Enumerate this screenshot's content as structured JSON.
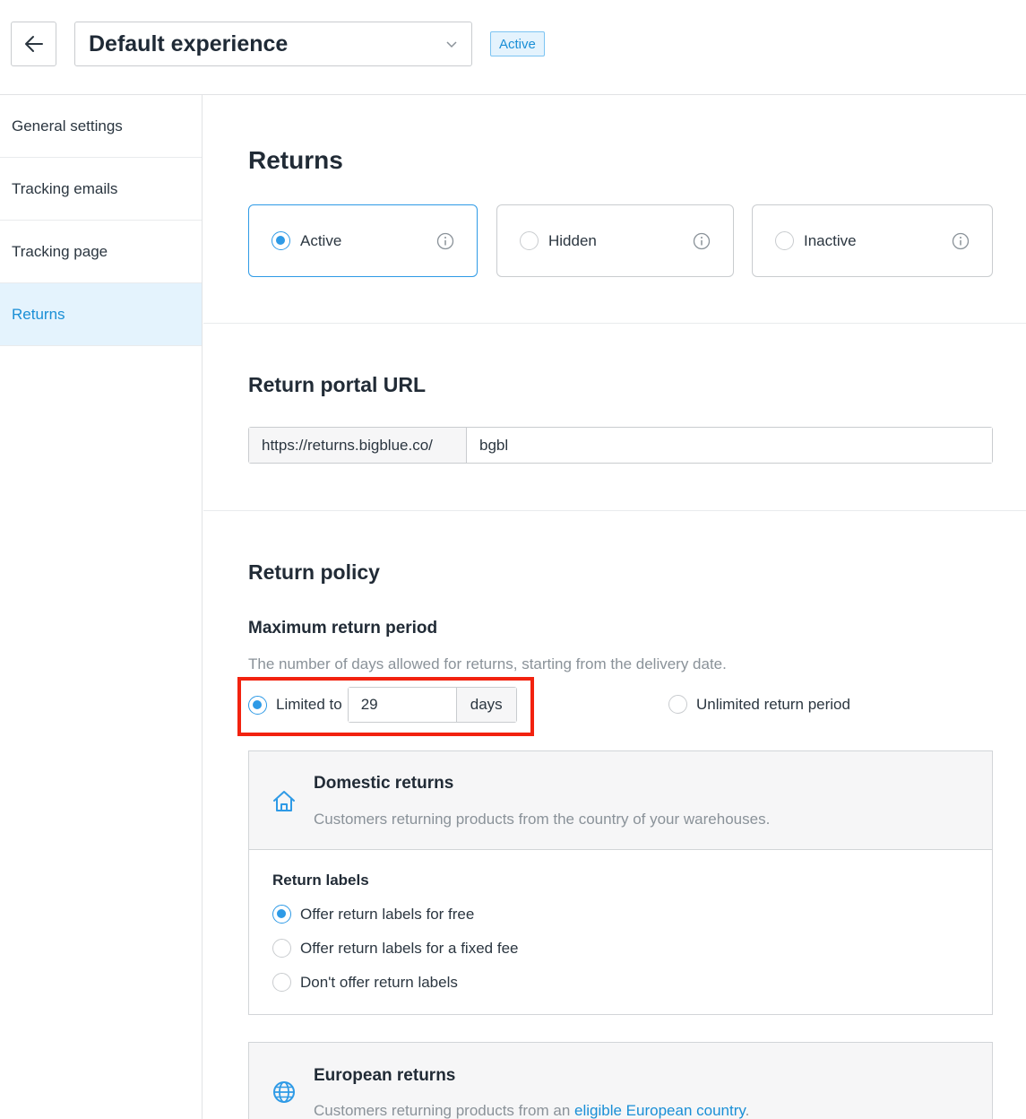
{
  "header": {
    "experience_name": "Default experience",
    "status_badge": "Active"
  },
  "sidebar": {
    "items": [
      {
        "label": "General settings",
        "active": false
      },
      {
        "label": "Tracking emails",
        "active": false
      },
      {
        "label": "Tracking page",
        "active": false
      },
      {
        "label": "Returns",
        "active": true
      }
    ]
  },
  "returns": {
    "title": "Returns",
    "options": [
      {
        "label": "Active",
        "selected": true
      },
      {
        "label": "Hidden",
        "selected": false
      },
      {
        "label": "Inactive",
        "selected": false
      }
    ]
  },
  "portal": {
    "title": "Return portal URL",
    "prefix": "https://returns.bigblue.co/",
    "slug": "bgbl"
  },
  "policy": {
    "title": "Return policy",
    "max_period_title": "Maximum return period",
    "max_period_help": "The number of days allowed for returns, starting from the delivery date.",
    "limited_label": "Limited to",
    "days_value": "29",
    "days_suffix": "days",
    "unlimited_label": "Unlimited return period",
    "limited_selected": true
  },
  "domestic": {
    "title": "Domestic returns",
    "description": "Customers returning products from the country of your warehouses.",
    "labels_title": "Return labels",
    "label_options": [
      {
        "label": "Offer return labels for free",
        "selected": true
      },
      {
        "label": "Offer return labels for a fixed fee",
        "selected": false
      },
      {
        "label": "Don't offer return labels",
        "selected": false
      }
    ]
  },
  "european": {
    "title": "European returns",
    "description_prefix": "Customers returning products from an ",
    "description_link": "eligible European country",
    "description_suffix": "."
  },
  "colors": {
    "accent": "#2e9ae6",
    "highlight": "#f2220f",
    "sidebar_active_bg": "#e4f3fd"
  }
}
